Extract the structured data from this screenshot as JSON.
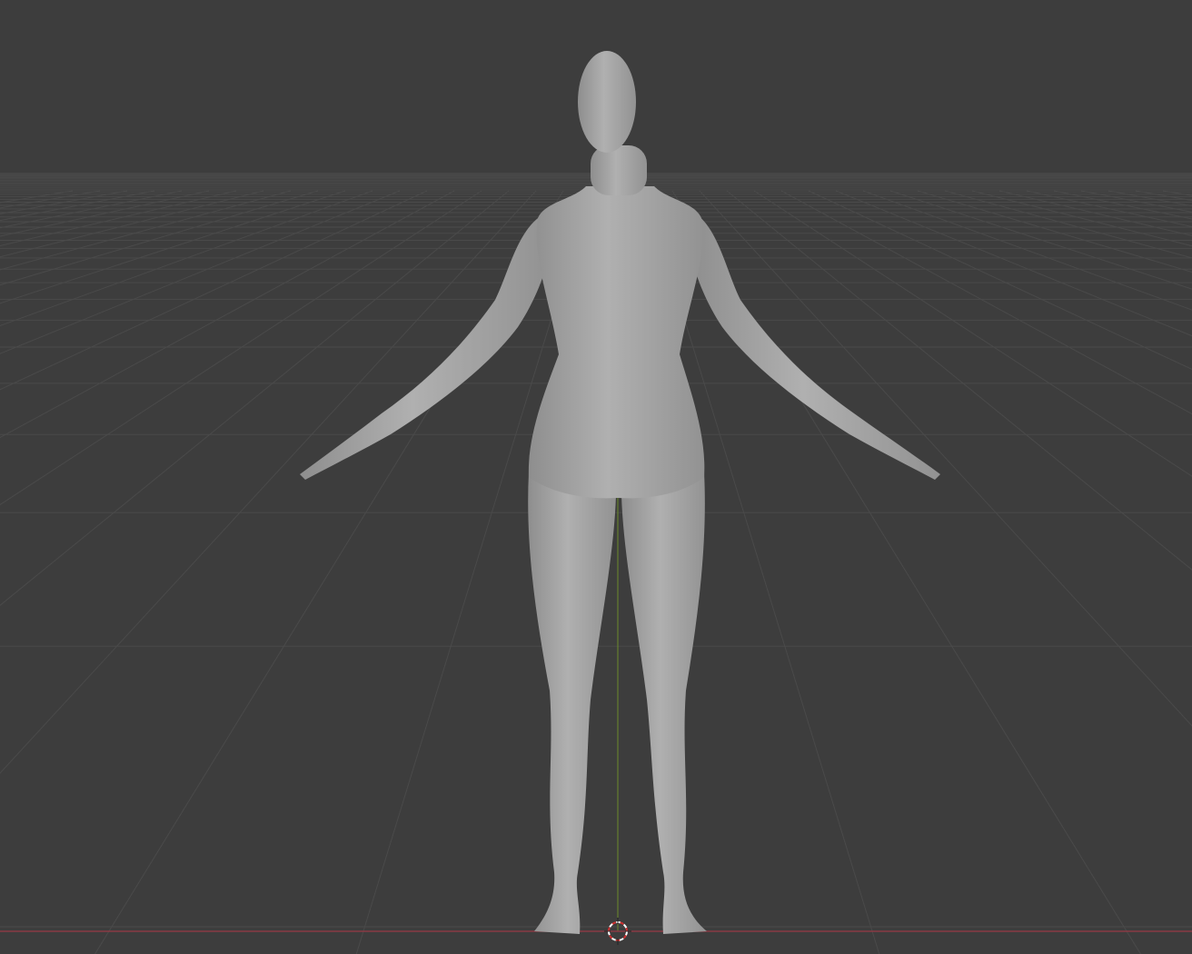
{
  "viewport": {
    "background": "#3d3d3d",
    "grid_color": "#4a4a4a",
    "x_axis_color": "#8a3a44",
    "y_axis_color": "#6a8a2a",
    "model_color": "#a9a9a9",
    "model_shadow": "#8a8a8a"
  },
  "icons": {
    "cursor": "3d-cursor-icon"
  }
}
